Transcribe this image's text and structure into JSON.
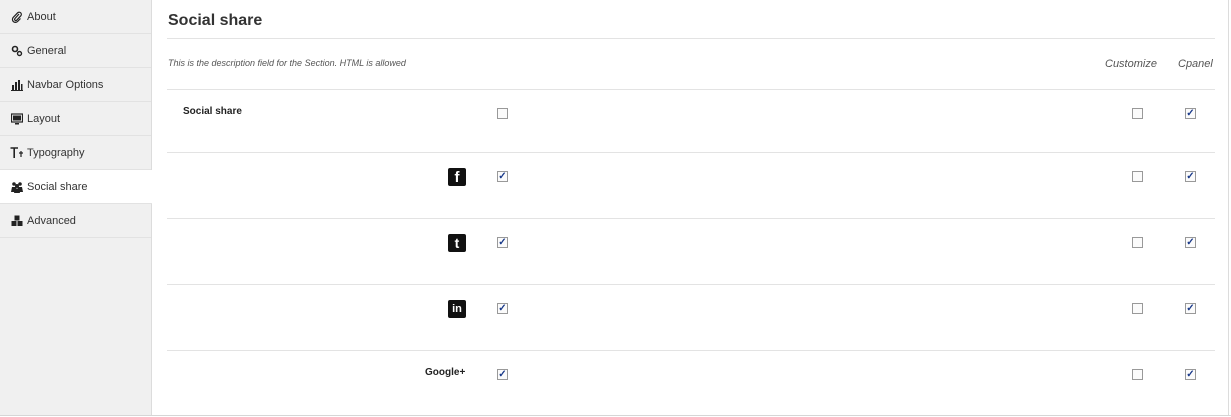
{
  "sidebar": {
    "items": [
      {
        "label": "About",
        "icon": "paperclip-icon",
        "active": false
      },
      {
        "label": "General",
        "icon": "gears-icon",
        "active": false
      },
      {
        "label": "Navbar Options",
        "icon": "bar-chart-icon",
        "active": false
      },
      {
        "label": "Layout",
        "icon": "monitor-icon",
        "active": false
      },
      {
        "label": "Typography",
        "icon": "text-size-icon",
        "active": false
      },
      {
        "label": "Social share",
        "icon": "users-icon",
        "active": true
      },
      {
        "label": "Advanced",
        "icon": "cubes-icon",
        "active": false
      }
    ]
  },
  "section": {
    "title": "Social share",
    "description": "This is the description field for the Section. HTML is allowed",
    "columns": {
      "customize": "Customize",
      "cpanel": "Cpanel"
    }
  },
  "rows": [
    {
      "label": "Social share",
      "icon": null,
      "enabled": false,
      "customize": false,
      "cpanel": true
    },
    {
      "label": "",
      "icon": "facebook-icon",
      "enabled": true,
      "customize": false,
      "cpanel": true
    },
    {
      "label": "",
      "icon": "twitter-icon",
      "enabled": true,
      "customize": false,
      "cpanel": true
    },
    {
      "label": "",
      "icon": "linkedin-icon",
      "enabled": true,
      "customize": false,
      "cpanel": true
    },
    {
      "label": "Google+",
      "icon": null,
      "enabled": true,
      "customize": false,
      "cpanel": true
    }
  ],
  "colors": {
    "checkmark": "#1a3a8a",
    "sidebar_bg": "#f0f0f0"
  }
}
